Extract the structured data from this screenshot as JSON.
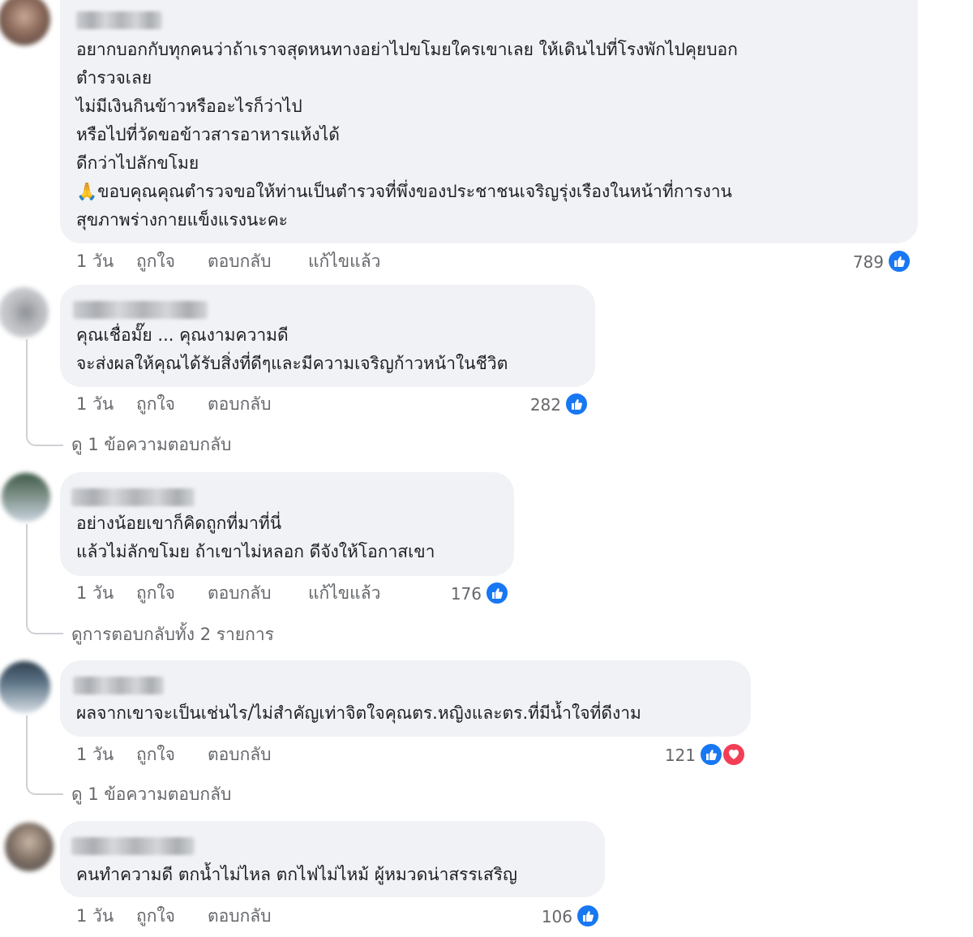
{
  "comments": [
    {
      "lines": [
        "อยากบอกกับทุกคนว่าถ้าเราจสุดหนทางอย่าไปขโมยใครเขาเลย ให้เดินไปที่โรงพักไปคุยบอก",
        "ตำรวจเลย",
        "ไม่มีเงินกินข้าวหรืออะไรก็ว่าไป",
        "หรือไปที่วัดขอข้าวสารอาหารแห้งได้",
        "ดีกว่าไปลักขโมย",
        "🙏ขอบคุณคุณตำรวจขอให้ท่านเป็นตำรวจที่พึ่งของประชาชนเจริญรุ่งเรืองในหน้าที่การงาน",
        "สุขภาพร่างกายแข็งแรงนะคะ"
      ],
      "time": "1 วัน",
      "like": "ถูกใจ",
      "reply": "ตอบกลับ",
      "edited": "แก้ไขแล้ว",
      "reactions": "789"
    },
    {
      "lines": [
        "คุณเชื่อมั๊ย ... คุณงามความดี",
        "จะส่งผลให้คุณได้รับสิ่งที่ดีๆและมีความเจริญก้าวหน้าในชีวิต"
      ],
      "time": "1 วัน",
      "like": "ถูกใจ",
      "reply": "ตอบกลับ",
      "reactions": "282",
      "view_replies": "ดู 1 ข้อความตอบกลับ"
    },
    {
      "lines": [
        "อย่างน้อยเขาก็คิดถูกที่มาที่นี่",
        "แล้วไม่ลักขโมย ถ้าเขาไม่หลอก ดีจังให้โอกาสเขา"
      ],
      "time": "1 วัน",
      "like": "ถูกใจ",
      "reply": "ตอบกลับ",
      "edited": "แก้ไขแล้ว",
      "reactions": "176",
      "view_replies": "ดูการตอบกลับทั้ง 2 รายการ"
    },
    {
      "lines": [
        "ผลจากเขาจะเป็นเช่นไร/ไม่สำคัญเท่าจิตใจคุณตร.หญิงและตร.ที่มีน้ำใจที่ดีงาม"
      ],
      "time": "1 วัน",
      "like": "ถูกใจ",
      "reply": "ตอบกลับ",
      "reactions": "121",
      "view_replies": "ดู 1 ข้อความตอบกลับ"
    },
    {
      "lines": [
        "คนทำความดี ตกน้ำไม่ไหล ตกไฟไม่ไหม้ ผู้หมวดน่าสรรเสริญ"
      ],
      "time": "1 วัน",
      "like": "ถูกใจ",
      "reply": "ตอบกลับ",
      "reactions": "106"
    }
  ],
  "colors": {
    "bubble": "#f0f2f5",
    "meta_text": "#65676b",
    "like_blue": "#1877f2",
    "love_red": "#f33e58"
  },
  "icons": [
    "like-icon",
    "love-icon"
  ]
}
